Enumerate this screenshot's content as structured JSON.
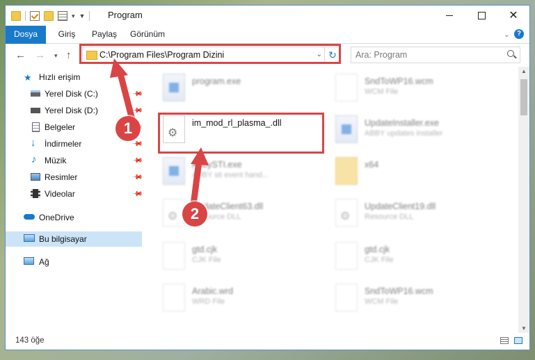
{
  "window": {
    "title": "Program",
    "controls": {
      "minimize": "minimize-icon",
      "maximize": "maximize-icon",
      "close": "✕"
    }
  },
  "ribbon": {
    "tabs": [
      "Dosya",
      "Giriş",
      "Paylaş",
      "Görünüm"
    ],
    "help": "?"
  },
  "nav": {
    "address": "C:\\Program Files\\Program Dizini",
    "search_placeholder": "Ara: Program"
  },
  "sidebar": {
    "items": [
      {
        "label": "Hızlı erişim",
        "icon": "star-icon",
        "pinned": false
      },
      {
        "label": "Yerel Disk (C:)",
        "icon": "drive-icon",
        "pinned": true
      },
      {
        "label": "Yerel Disk (D:)",
        "icon": "drive-icon",
        "pinned": true
      },
      {
        "label": "Belgeler",
        "icon": "document-icon",
        "pinned": true
      },
      {
        "label": "İndirmeler",
        "icon": "download-icon",
        "pinned": true
      },
      {
        "label": "Müzik",
        "icon": "music-icon",
        "pinned": true
      },
      {
        "label": "Resimler",
        "icon": "pictures-icon",
        "pinned": true
      },
      {
        "label": "Videolar",
        "icon": "video-icon",
        "pinned": true
      },
      {
        "label": "OneDrive",
        "icon": "cloud-icon",
        "pinned": false
      },
      {
        "label": "Bu bilgisayar",
        "icon": "computer-icon",
        "pinned": false
      },
      {
        "label": "Ağ",
        "icon": "network-icon",
        "pinned": false
      }
    ]
  },
  "files": [
    {
      "name": "program.exe",
      "type": "",
      "icon": "exe"
    },
    {
      "name": "SndToWP16.wcm",
      "type": "WCM File",
      "icon": "doc"
    },
    {
      "name": "im_mod_rl_plasma_.dll",
      "type": "",
      "icon": "gear"
    },
    {
      "name": "UpdateInstaller.exe",
      "type": "ABBY updates installer",
      "icon": "exe"
    },
    {
      "name": "AbbySTI.exe",
      "type": "ABBY sti event hand...",
      "icon": "exe"
    },
    {
      "name": "x64",
      "type": "",
      "icon": "folder"
    },
    {
      "name": "UpdateClient63.dll",
      "type": "Resource DLL",
      "icon": "gear"
    },
    {
      "name": "UpdateClient19.dll",
      "type": "Resource DLL",
      "icon": "gear"
    },
    {
      "name": "gtd.cjk",
      "type": "CJK File",
      "icon": "doc"
    },
    {
      "name": "gtd.cjk",
      "type": "CJK File",
      "icon": "doc"
    },
    {
      "name": "Arabic.wrd",
      "type": "WRD File",
      "icon": "doc"
    },
    {
      "name": "SndToWP16.wcm",
      "type": "WCM File",
      "icon": "doc"
    }
  ],
  "annotations": {
    "step1": "1",
    "step2": "2",
    "color": "#d94545"
  },
  "status": {
    "count": "143 öğe"
  },
  "colors": {
    "accent": "#1979ca",
    "selected": "#cce4f7"
  }
}
